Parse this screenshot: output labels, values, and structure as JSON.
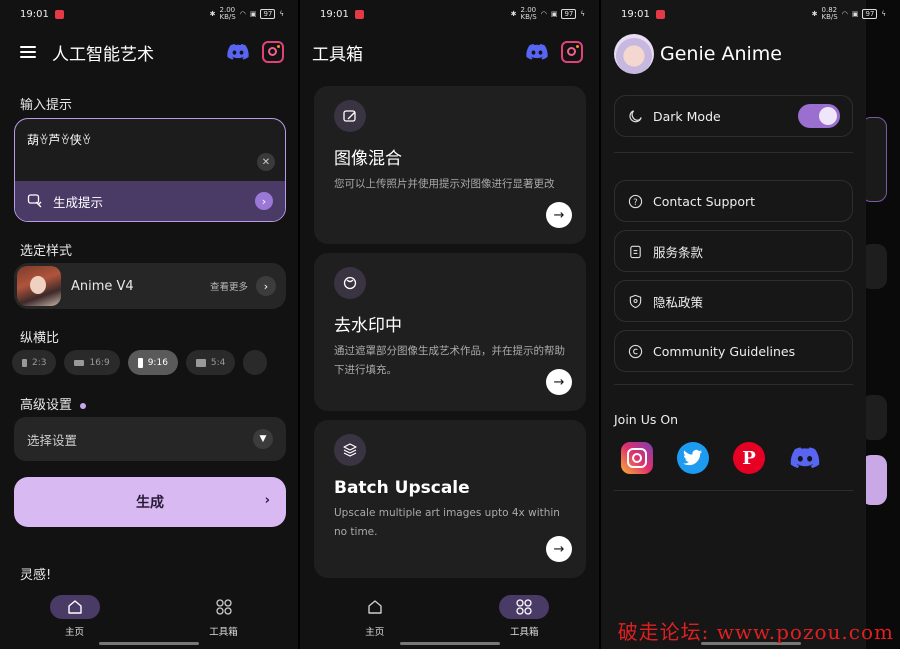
{
  "status": {
    "time": "19:01",
    "net1": "2.00\nKB/S",
    "net3": "0.82\nKB/S",
    "battery": "97"
  },
  "home": {
    "title": "人工智能艺术",
    "prompt_label": "输入提示",
    "prompt_value": "葫ꈊ芦ꈊ侠ꈊ",
    "gen_prompt": "生成提示",
    "style_label": "选定样式",
    "style_name": "Anime V4",
    "see_more": "查看更多",
    "ratio_label": "纵横比",
    "ratios": [
      {
        "label": "2:3",
        "w": 5,
        "h": 8,
        "active": false
      },
      {
        "label": "16:9",
        "w": 10,
        "h": 6,
        "active": false
      },
      {
        "label": "9:16",
        "w": 5,
        "h": 10,
        "active": true
      },
      {
        "label": "5:4",
        "w": 10,
        "h": 8,
        "active": false
      }
    ],
    "advanced_label": "高级设置",
    "select_placeholder": "选择设置",
    "generate": "生成",
    "inspire": "灵感!"
  },
  "nav": {
    "home": "主页",
    "tools": "工具箱"
  },
  "tools": {
    "title": "工具箱",
    "cards": [
      {
        "title": "图像混合",
        "desc": "您可以上传照片并使用提示对图像进行显著更改"
      },
      {
        "title": "去水印中",
        "desc": "通过遮罩部分图像生成艺术作品，并在提示的帮助下进行填充。"
      },
      {
        "title": "Batch Upscale",
        "desc": "Upscale multiple art images upto 4x within no time."
      }
    ]
  },
  "drawer": {
    "app_name": "Genie Anime",
    "dark_mode": "Dark Mode",
    "dark_mode_on": true,
    "contact": "Contact Support",
    "terms": "服务条款",
    "privacy": "隐私政策",
    "guidelines": "Community Guidelines",
    "join": "Join Us On"
  },
  "watermark": "破走论坛: www.pozou.com",
  "colors": {
    "accent": "#d9b9f2",
    "accent_dark": "#4a3a66",
    "bg": "#121212",
    "card": "#1f1f1f"
  }
}
